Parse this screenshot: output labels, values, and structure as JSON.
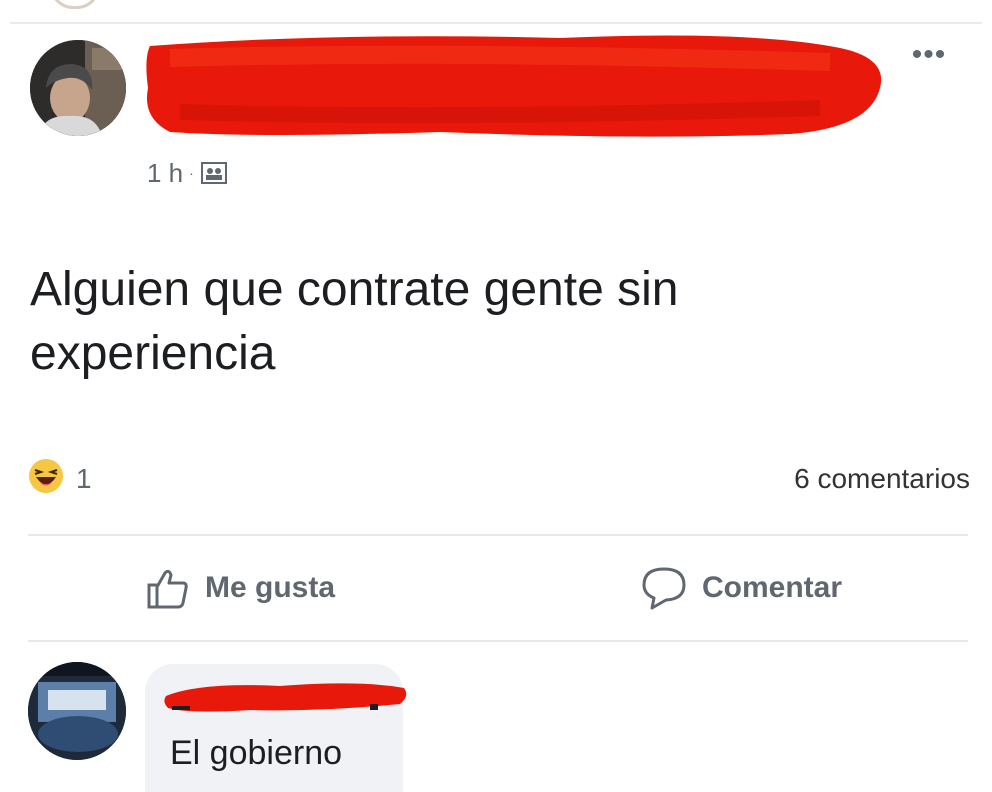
{
  "post": {
    "timestamp": "1 h",
    "separator": "·",
    "audience_icon": "friends-icon",
    "more_label": "•••",
    "text": "Alguien que contrate gente sin experiencia"
  },
  "reactions": {
    "icon": "haha-reaction-icon",
    "count": "1",
    "comments": "6 comentarios"
  },
  "actions": {
    "like_label": "Me gusta",
    "comment_label": "Comentar"
  },
  "comment": {
    "text": "El gobierno"
  },
  "colors": {
    "redaction": "#e8190b",
    "meta_text": "#606770",
    "bubble": "#f0f2f5"
  }
}
